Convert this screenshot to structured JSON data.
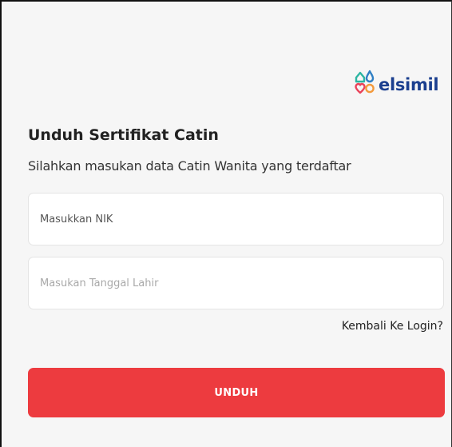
{
  "brand": {
    "name": "elsimil",
    "logo_icon": "elsimil-logo-icon",
    "colors": {
      "text": "#1b3f8f",
      "green": "#2cb5a2",
      "blue": "#2f7fc4",
      "red": "#ea4259",
      "orange": "#f39a3c"
    }
  },
  "form": {
    "title": "Unduh Sertifikat Catin",
    "subtitle": "Silahkan masukan data Catin Wanita yang terdaftar",
    "nik_placeholder": "Masukkan NIK",
    "dob_placeholder": "Masukan Tanggal Lahir",
    "back_link": "Kembali Ke Login?",
    "submit_label": "UNDUH",
    "accent_color": "#ed3b3f"
  }
}
